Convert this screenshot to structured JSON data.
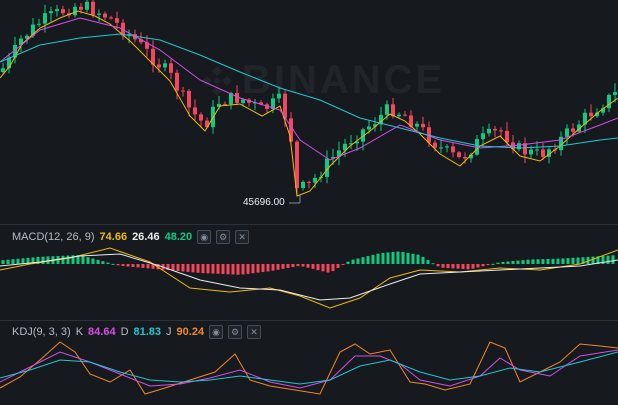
{
  "watermark": "BINANCE",
  "low_marker": {
    "label": "45696.00"
  },
  "macd": {
    "label": "MACD(12, 26, 9)",
    "dif": "74.66",
    "dea": "26.46",
    "macd": "48.20",
    "colors": {
      "dif": "#f0b90b",
      "dea": "#eaecef",
      "pos": "#0ecb81",
      "neg": "#f6465d"
    }
  },
  "kdj": {
    "label": "KDJ(9, 3, 3)",
    "k_label": "K",
    "k": "84.64",
    "d_label": "D",
    "d": "81.83",
    "j_label": "J",
    "j": "90.24",
    "colors": {
      "k": "#d34fe6",
      "d": "#1fc7d4",
      "j": "#f0882d"
    }
  },
  "candle_colors": {
    "up": "#0ecb81",
    "down": "#f6465d"
  },
  "ma_colors": [
    "#f0b90b",
    "#d34fe6",
    "#1fc7d4"
  ],
  "tool_icons": [
    "eye-icon",
    "settings-icon",
    "close-icon"
  ]
}
